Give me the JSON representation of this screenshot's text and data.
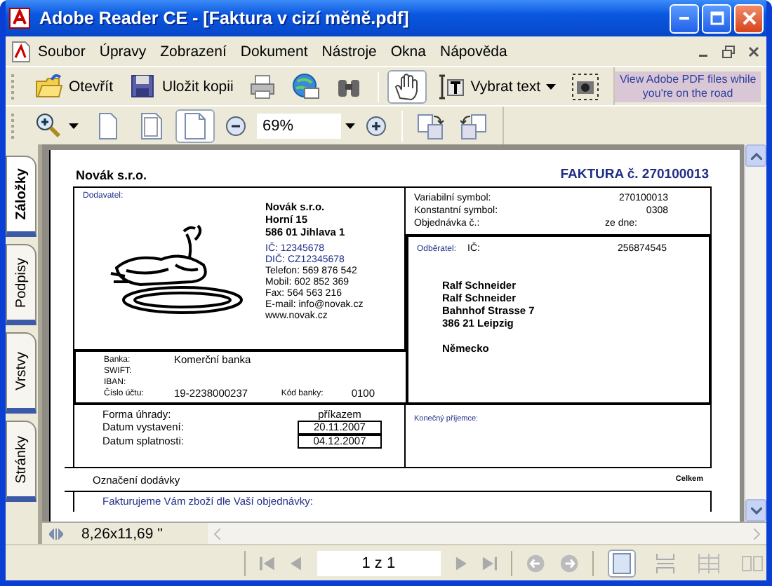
{
  "window": {
    "title": "Adobe Reader CE - [Faktura v cizí měně.pdf]"
  },
  "menu": [
    {
      "label": "Soubor"
    },
    {
      "label": "Úpravy"
    },
    {
      "label": "Zobrazení"
    },
    {
      "label": "Dokument"
    },
    {
      "label": "Nástroje"
    },
    {
      "label": "Okna"
    },
    {
      "label": "Nápověda"
    }
  ],
  "toolbar": [
    {
      "kind": "open",
      "label": "Otevřít",
      "selected": false
    },
    {
      "kind": "save",
      "label": "Uložit kopii",
      "selected": false
    },
    {
      "kind": "print",
      "selected": false
    },
    {
      "kind": "email",
      "selected": false
    },
    {
      "kind": "find",
      "selected": false
    },
    {
      "kind": "sep"
    },
    {
      "kind": "hand",
      "selected": true
    },
    {
      "kind": "select",
      "label": "Vybrat text",
      "selected": false
    },
    {
      "kind": "snapshot",
      "selected": false
    }
  ],
  "ad": {
    "text": "View Adobe PDF files while you're on the road"
  },
  "toolbar2": [
    {
      "kind": "zoomin",
      "selected": false
    },
    {
      "kind": "actual",
      "selected": false
    },
    {
      "kind": "fitwidth",
      "selected": false
    },
    {
      "kind": "fitpage",
      "selected": true
    },
    {
      "kind": "minus",
      "selected": false
    },
    {
      "kind": "zoomfield",
      "value": "69%"
    },
    {
      "kind": "plus",
      "selected": false
    },
    {
      "kind": "sep"
    },
    {
      "kind": "rotcw",
      "selected": false
    },
    {
      "kind": "rotccw",
      "selected": false
    }
  ],
  "side_tabs": [
    {
      "label": "Záložky",
      "selected": true
    },
    {
      "label": "Podpisy",
      "selected": false
    },
    {
      "label": "Vrstvy",
      "selected": false
    },
    {
      "label": "Stránky",
      "selected": false
    }
  ],
  "document": {
    "company": "Novák s.r.o.",
    "invoice_title": "FAKTURA č. 270100013",
    "supplier": {
      "label": "Dodavatel:",
      "address": [
        "Novák s.r.o.",
        "Horní 15",
        "586 01 Jihlava 1"
      ],
      "ids": [
        "IČ: 12345678",
        "DIČ: CZ12345678"
      ],
      "contacts": [
        "Telefon: 569 876 542",
        "Mobil: 602 852 369",
        "Fax: 564 563 216",
        "E-mail: info@novak.cz",
        "www.novak.cz"
      ]
    },
    "bank": [
      {
        "label": "Banka:",
        "value": "Komerční banka"
      },
      {
        "label": "SWIFT:"
      },
      {
        "label": "IBAN:"
      },
      {
        "label": "Číslo účtu:",
        "value": "19-2238000237",
        "code_label": "Kód banky:",
        "code": "0100"
      }
    ],
    "symbols": [
      {
        "label": "Variabilní symbol:",
        "value": "270100013"
      },
      {
        "label": "Konstantní symbol:",
        "value": "0308"
      },
      {
        "label": "Objednávka č.:",
        "date_label": "ze dne:"
      }
    ],
    "customer": {
      "label": "Odběratel:",
      "ic_label": "IČ:",
      "ic": "256874545",
      "address": [
        "Ralf Schneider",
        "Ralf Schneider",
        "Bahnhof Strasse 7",
        "386 21 Leipzig"
      ],
      "country": "Německo"
    },
    "payment": [
      {
        "label": "Forma úhrady:",
        "value": "příkazem",
        "boxed": false
      },
      {
        "label": "Datum vystavení:",
        "value": "20.11.2007",
        "boxed": true
      },
      {
        "label": "Datum splatnosti:",
        "value": "04.12.2007",
        "boxed": true
      }
    ],
    "final_recipient": "Konečný příjemce:",
    "items_header": {
      "name": "Označení dodávky",
      "total": "Celkem"
    },
    "intro": "Fakturujeme Vám zboží dle Vaší objednávky:"
  },
  "status": {
    "page_size": "8,26x11,69 \""
  },
  "nav": {
    "page": "1 z 1",
    "layouts": [
      {
        "kind": "single",
        "selected": true
      },
      {
        "kind": "continuous",
        "selected": false
      },
      {
        "kind": "facing",
        "selected": false
      },
      {
        "kind": "cfacing",
        "selected": false
      }
    ]
  }
}
